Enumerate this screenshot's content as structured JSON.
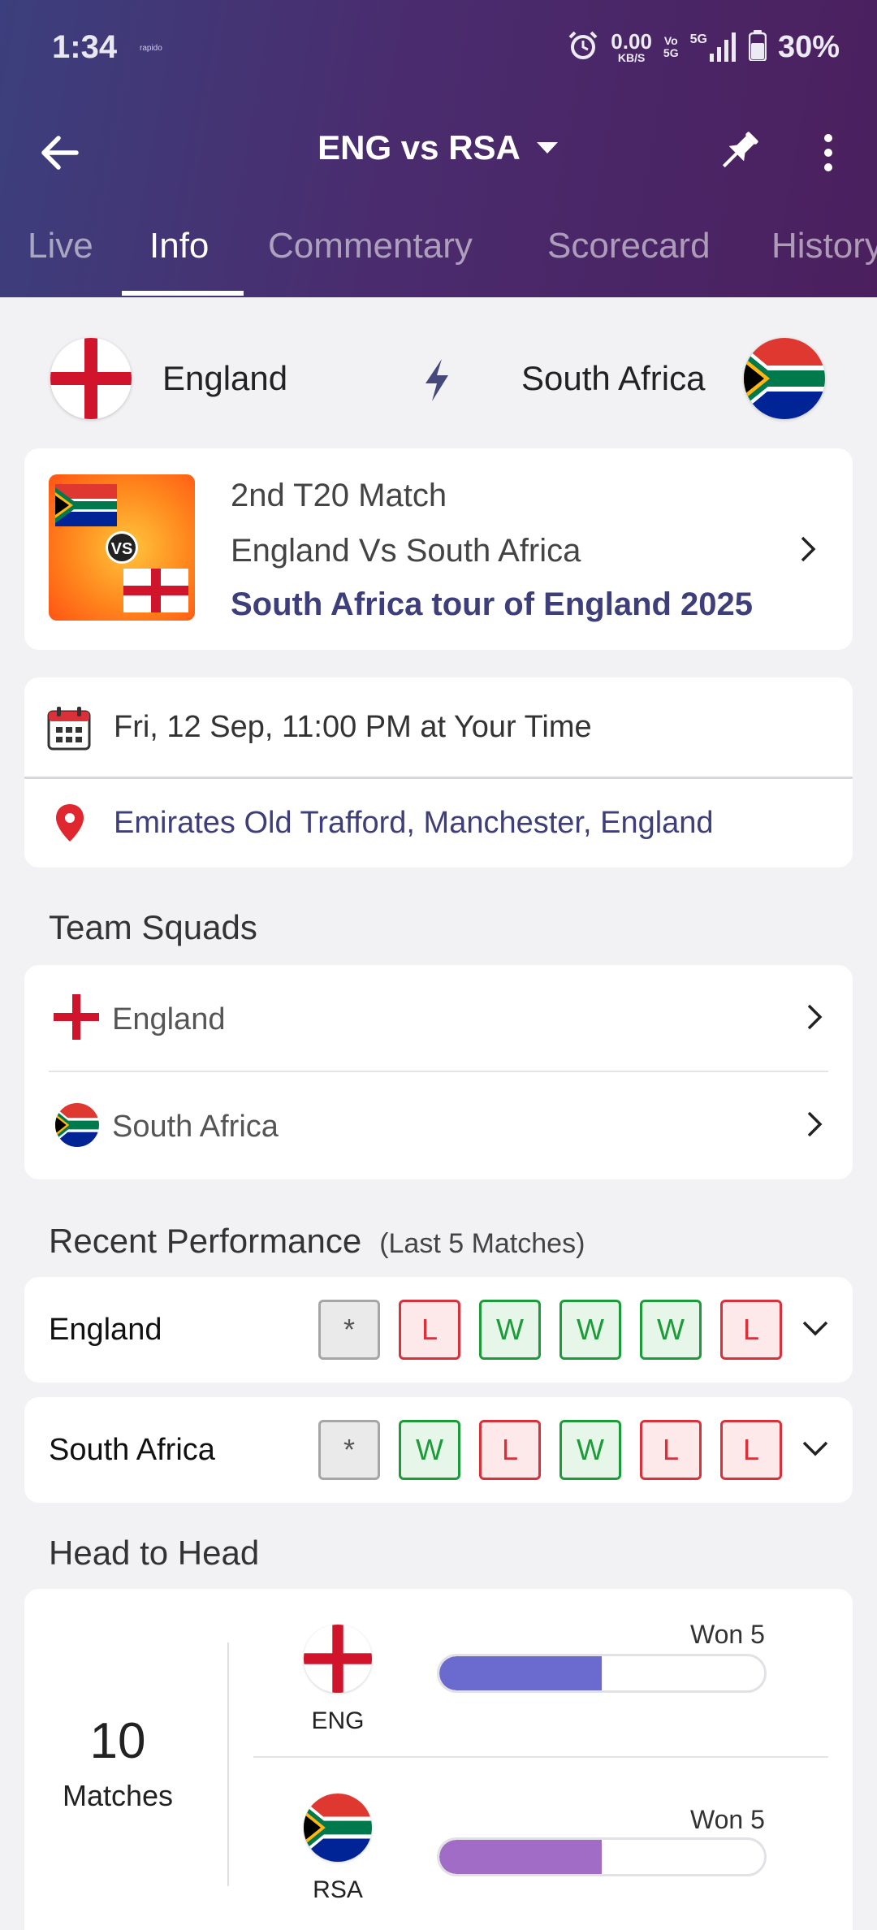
{
  "status_bar": {
    "time": "1:34",
    "tiny_label": "rapido",
    "net_speed_value": "0.00",
    "net_speed_unit": "KB/S",
    "volte_top": "Vo",
    "volte_bottom": "5G",
    "network": "5G",
    "battery": "30%"
  },
  "app_bar": {
    "title": "ENG vs RSA"
  },
  "tabs": [
    {
      "label": "Live",
      "active": false
    },
    {
      "label": "Info",
      "active": true
    },
    {
      "label": "Commentary",
      "active": false
    },
    {
      "label": "Scorecard",
      "active": false
    },
    {
      "label": "History",
      "active": false
    }
  ],
  "teams": {
    "home": "England",
    "away": "South Africa"
  },
  "match": {
    "vs_badge": "VS",
    "line1": "2nd T20 Match",
    "line2": "England Vs South Africa",
    "series": "South Africa tour of England 2025"
  },
  "schedule": {
    "datetime": "Fri, 12 Sep, 11:00 PM at Your Time",
    "venue": "Emirates Old Trafford, Manchester, England"
  },
  "team_squads": {
    "title": "Team Squads",
    "items": [
      "England",
      "South Africa"
    ]
  },
  "recent_performance": {
    "title": "Recent Performance",
    "subtitle": "(Last 5 Matches)",
    "rows": [
      {
        "team": "England",
        "results": [
          "*",
          "L",
          "W",
          "W",
          "W",
          "L"
        ]
      },
      {
        "team": "South Africa",
        "results": [
          "*",
          "W",
          "L",
          "W",
          "L",
          "L"
        ]
      }
    ]
  },
  "head_to_head": {
    "title": "Head to Head",
    "matches_count": "10",
    "matches_label": "Matches",
    "teams": [
      {
        "abbr": "ENG",
        "won_label": "Won 5",
        "won": 5,
        "color": "#6b6bcf"
      },
      {
        "abbr": "RSA",
        "won_label": "Won 5",
        "won": 5,
        "color": "#a06cc6"
      }
    ]
  },
  "colors": {
    "header_start": "#3c3f7d",
    "header_end": "#4b1f5e",
    "accent_text": "#3e3e7a",
    "win": "#1d9b3a",
    "loss": "#d9303a"
  }
}
